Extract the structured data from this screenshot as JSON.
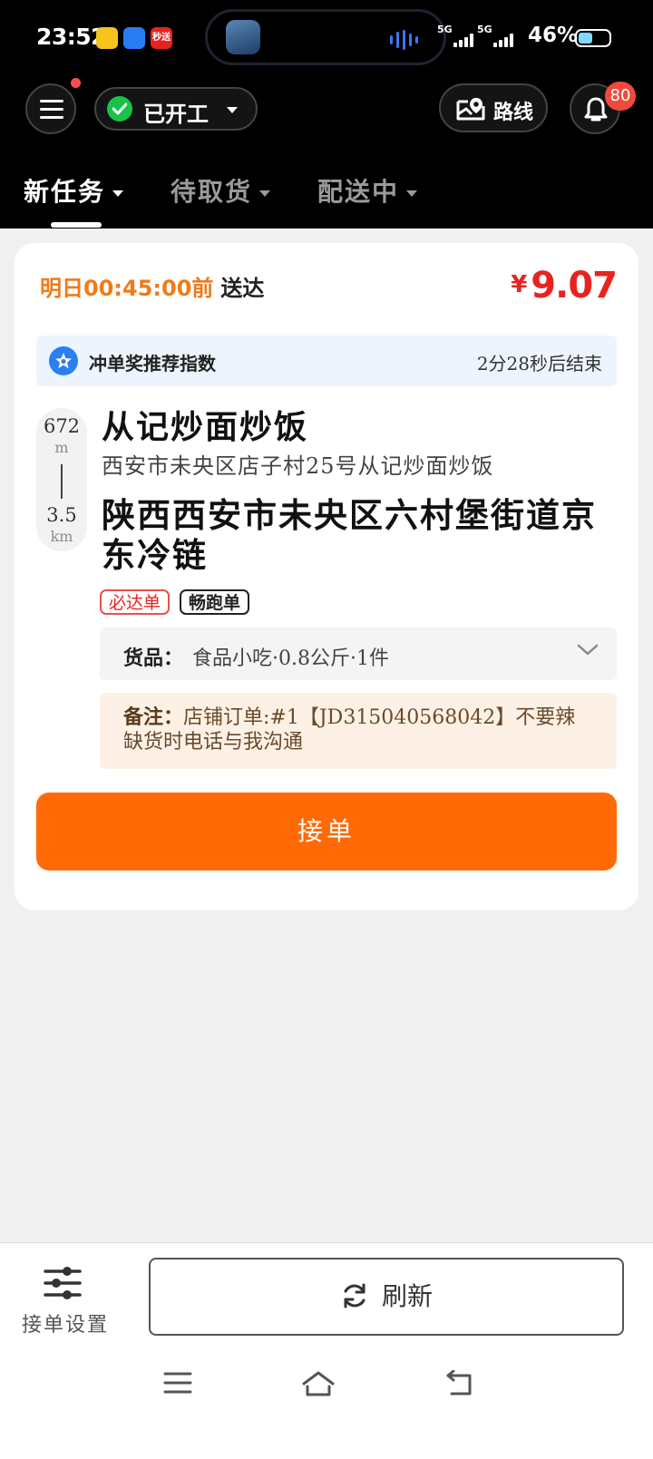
{
  "status_bar": {
    "time": "23:52",
    "app_badges": [
      "秒送"
    ],
    "network_1": "5G",
    "network_2": "5G",
    "battery_percent": "46%",
    "battery_level": 0.46
  },
  "header": {
    "work_status": "已开工",
    "route_label": "路线",
    "notification_count": "80",
    "tabs": [
      {
        "label": "新任务",
        "active": true
      },
      {
        "label": "待取货",
        "active": false
      },
      {
        "label": "配送中",
        "active": false
      }
    ]
  },
  "order": {
    "deadline_time": "明日00:45:00前",
    "deadline_suffix": "送达",
    "currency": "¥",
    "price": "9.07",
    "bonus_title": "冲单奖推荐指数",
    "bonus_timer": "2分28秒后结束",
    "distance_pickup": "672",
    "distance_pickup_unit": "m",
    "distance_delivery": "3.5",
    "distance_delivery_unit": "km",
    "shop_name": "从记炒面炒饭",
    "shop_address": "西安市未央区店子村25号从记炒面炒饭",
    "delivery_address": "陕西西安市未央区六村堡街道京东冷链",
    "tags": [
      "必达单",
      "畅跑单"
    ],
    "goods_label": "货品：",
    "goods_value": "食品小吃·0.8公斤·1件",
    "note_label": "备注：",
    "note_value": "店铺订单:#1【JD315040568042】不要辣 缺货时电话与我沟通",
    "accept_label": "接单"
  },
  "bottom": {
    "settings_label": "接单设置",
    "refresh_label": "刷新"
  },
  "colors": {
    "accent_orange": "#ff6a06",
    "price_red": "#e8231f",
    "deadline_orange": "#f07a1a",
    "online_green": "#19c24a",
    "bonus_blue": "#2b80f0"
  },
  "icons": [
    "menu-icon",
    "check-icon",
    "caret-down-icon",
    "map-pin-icon",
    "bell-icon",
    "star-badge-icon",
    "chevron-down-icon",
    "sliders-icon",
    "refresh-icon",
    "nav-menu-icon",
    "nav-home-icon",
    "nav-back-icon"
  ]
}
